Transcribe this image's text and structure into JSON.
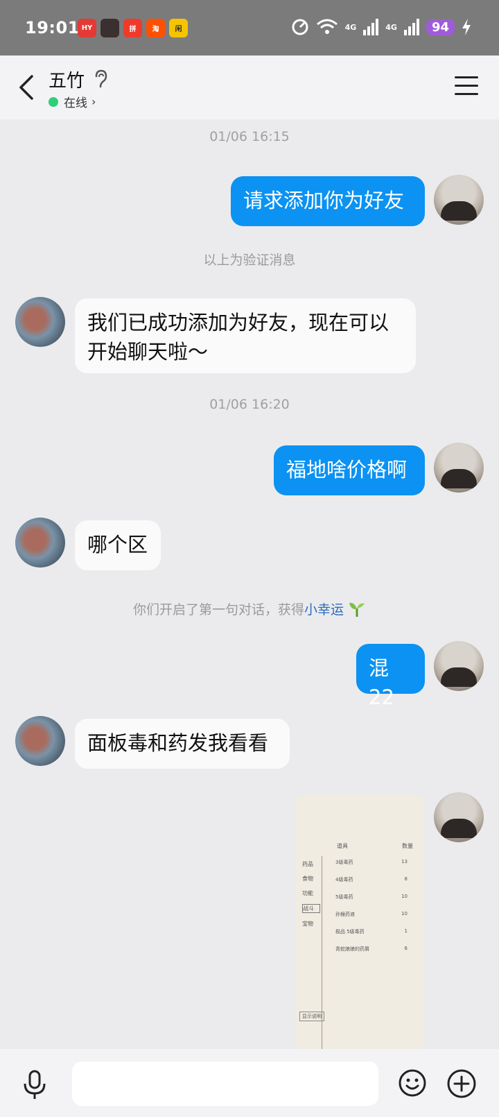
{
  "status_bar": {
    "time": "19:01",
    "apps": [
      {
        "icon": "app-red-icon",
        "color": "#e53935",
        "text": "HY"
      },
      {
        "icon": "app-avatar-icon",
        "color": "#3b2f2f",
        "text": ""
      },
      {
        "icon": "app-pdd-icon",
        "color": "#ef3a2b",
        "text": "拼"
      },
      {
        "icon": "app-taobao-icon",
        "color": "#ff5000",
        "text": "淘"
      },
      {
        "icon": "app-yellow-icon",
        "color": "#f5c400",
        "text": "闲"
      }
    ],
    "signal1": "4G",
    "signal2": "4G",
    "battery": "94"
  },
  "header": {
    "title": "五竹",
    "status": "在线",
    "back_icon": "back-arrow-icon",
    "menu_icon": "hamburger-menu-icon"
  },
  "chat": {
    "timestamp1": "01/06 16:15",
    "msg1": "请求添加你为好友",
    "system1": "以上为验证消息",
    "msg2": "我们已成功添加为好友，现在可以开始聊天啦～",
    "timestamp2": "01/06 16:20",
    "msg3": "福地啥价格啊",
    "msg4": "哪个区",
    "system2_prefix": "你们开启了第一句对话，获得",
    "system2_link": "小幸运",
    "msg5": "混22",
    "msg6": "面板毒和药发我看看"
  },
  "image_message": {
    "sidebar": [
      "药品",
      "食物",
      "功能",
      "战斗",
      "宝物"
    ],
    "selected": "战斗",
    "col_item": "道具",
    "col_qty": "数量",
    "rows": [
      {
        "name": "3级毒药",
        "qty": "13"
      },
      {
        "name": "4级毒药",
        "qty": "8"
      },
      {
        "name": "5级毒药",
        "qty": "10"
      },
      {
        "name": "孙猴药液",
        "qty": "10"
      },
      {
        "name": "极品 5级毒药",
        "qty": "1"
      },
      {
        "name": "青蛇娘娘的药屑",
        "qty": "6"
      }
    ],
    "button": "显示说明"
  },
  "input_bar": {
    "mic_icon": "microphone-icon",
    "emoji_icon": "emoji-icon",
    "plus_icon": "plus-icon"
  },
  "colors": {
    "my_bubble": "#0b92f2",
    "other_bubble": "#fafafa",
    "background": "#ebebed",
    "online_dot": "#2fce7a"
  }
}
